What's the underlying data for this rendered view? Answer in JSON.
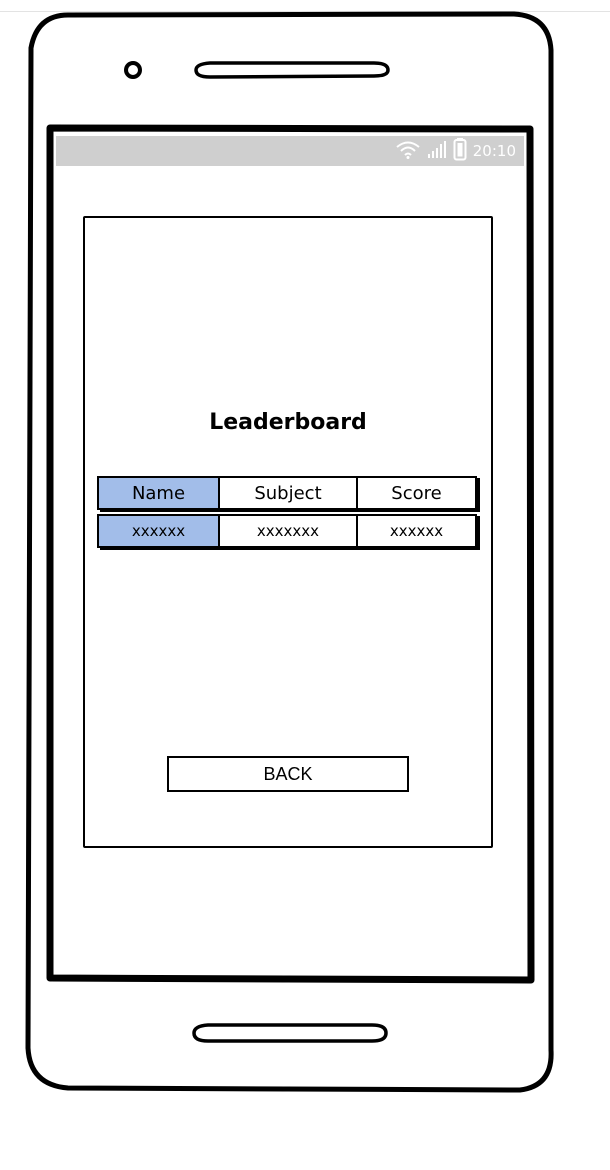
{
  "status_bar": {
    "time": "20:10",
    "icons": [
      "wifi-icon",
      "signal-icon",
      "battery-icon"
    ]
  },
  "screen": {
    "title": "Leaderboard",
    "table": {
      "headers": [
        "Name",
        "Subject",
        "Score"
      ],
      "rows": [
        [
          "xxxxxx",
          "xxxxxxx",
          "xxxxxx"
        ]
      ]
    },
    "back_label": "BACK"
  },
  "colors": {
    "name_column": "#a2bde9",
    "status_bar": "#cfcfcf"
  }
}
